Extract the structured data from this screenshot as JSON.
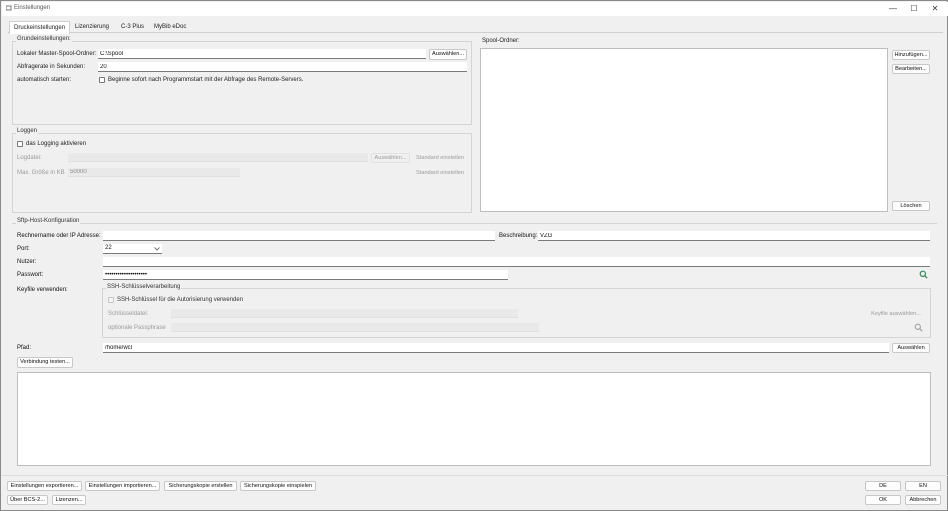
{
  "window": {
    "title": "Einstellungen",
    "controls": {
      "minimize": "—",
      "maximize": "☐",
      "close": "✕"
    }
  },
  "tabs": [
    {
      "label": "Druckeinstellungen",
      "active": true
    },
    {
      "label": "Lizenzierung"
    },
    {
      "label": "C-3 Plus"
    },
    {
      "label": "MyBib eDoc"
    }
  ],
  "grund": {
    "title": "Grundeinstellungen:",
    "spool_label": "Lokaler Master-Spool-Ordner:",
    "spool_value": "C:\\Spool",
    "spool_button": "Auswählen...",
    "rate_label": "Abfragerate in Sekunden:",
    "rate_value": "20",
    "autostart_label": "automatisch starten:",
    "autostart_text": "Beginne sofort nach Programmstart mit der Abfrage des Remote-Servers."
  },
  "loggen": {
    "title": "Loggen",
    "enable_label": "das Logging aktivieren",
    "file_label": "Logdatei:",
    "file_button": "Auswählen...",
    "file_default": "Standard einstellen",
    "max_label": "Max. Größe in KB",
    "max_value": "50000",
    "max_default": "Standard einstellen"
  },
  "spool": {
    "title": "Spool-Ordner:",
    "add": "Hinzufügen...",
    "edit": "Bearbeiten...",
    "delete": "Löschen"
  },
  "sftp": {
    "title": "Sftp-Host-Konfiguration",
    "host_label": "Rechnername oder IP Adresse:",
    "host_value": "",
    "desc_label": "Beschreibung:",
    "desc_value": "VZG",
    "port_label": "Port:",
    "port_value": "22",
    "user_label": "Nutzer:",
    "user_value": "",
    "pass_label": "Passwort:",
    "pass_value": "••••••••••••••••••••",
    "keyfile_label": "Keyfile verwenden:",
    "ssh_title": "SSH-Schlüsselverarbeitung",
    "ssh_check": "SSH-Schlüssel für die Autorisierung verwenden",
    "keyfile_file_label": "Schlüsseldatei:",
    "keyfile_button": "Keyfile auswählen...",
    "passphrase_label": "optionale Passphrase",
    "path_label": "Pfad:",
    "path_value": "/home/wcl",
    "path_button": "Auswählen",
    "test_button": "Verbindung testen..."
  },
  "footer": {
    "export": "Einstellungen exportieren...",
    "import": "Einstellungen importieren...",
    "backup_create": "Sicherungskopie erstellen",
    "backup_load": "Sicherungskopie einspielen",
    "about": "Über BCS-2...",
    "licenses": "Lizenzen...",
    "lang_de": "DE",
    "lang_en": "EN",
    "ok": "OK",
    "cancel": "Abbrechen"
  },
  "colors": {
    "accent_icon": "#2e8b57"
  }
}
